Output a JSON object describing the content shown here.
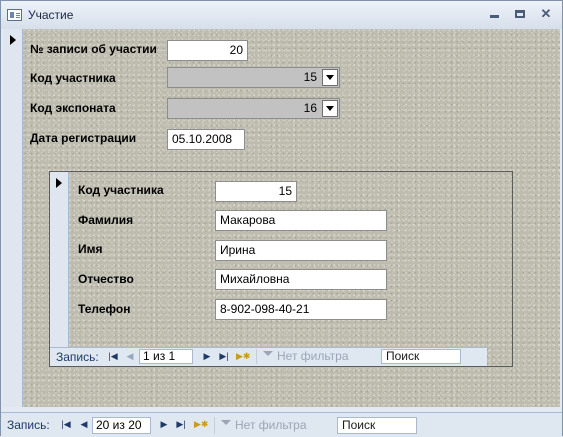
{
  "window": {
    "title": "Участие"
  },
  "main_form": {
    "fields": [
      {
        "label": "№ записи об участии",
        "value": "20"
      },
      {
        "label": "Код участника",
        "value": "15"
      },
      {
        "label": "Код экспоната",
        "value": "16"
      },
      {
        "label": "Дата регистрации",
        "value": "05.10.2008"
      }
    ]
  },
  "subform": {
    "fields": [
      {
        "label": "Код участника",
        "value": "15"
      },
      {
        "label": "Фамилия",
        "value": "Макарова"
      },
      {
        "label": "Имя",
        "value": "Ирина"
      },
      {
        "label": "Отчество",
        "value": "Михайловна"
      },
      {
        "label": "Телефон",
        "value": "8-902-098-40-21"
      }
    ],
    "nav": {
      "caption": "Запись:",
      "position": "1 из 1",
      "filter": "Нет фильтра",
      "search": "Поиск"
    }
  },
  "main_nav": {
    "caption": "Запись:",
    "position": "20 из 20",
    "filter": "Нет фильтра",
    "search": "Поиск"
  },
  "icons": {
    "first": "first-record-icon",
    "prev": "prev-record-icon",
    "next": "next-record-icon",
    "last": "last-record-icon",
    "new": "new-record-icon",
    "filter": "filter-icon"
  }
}
